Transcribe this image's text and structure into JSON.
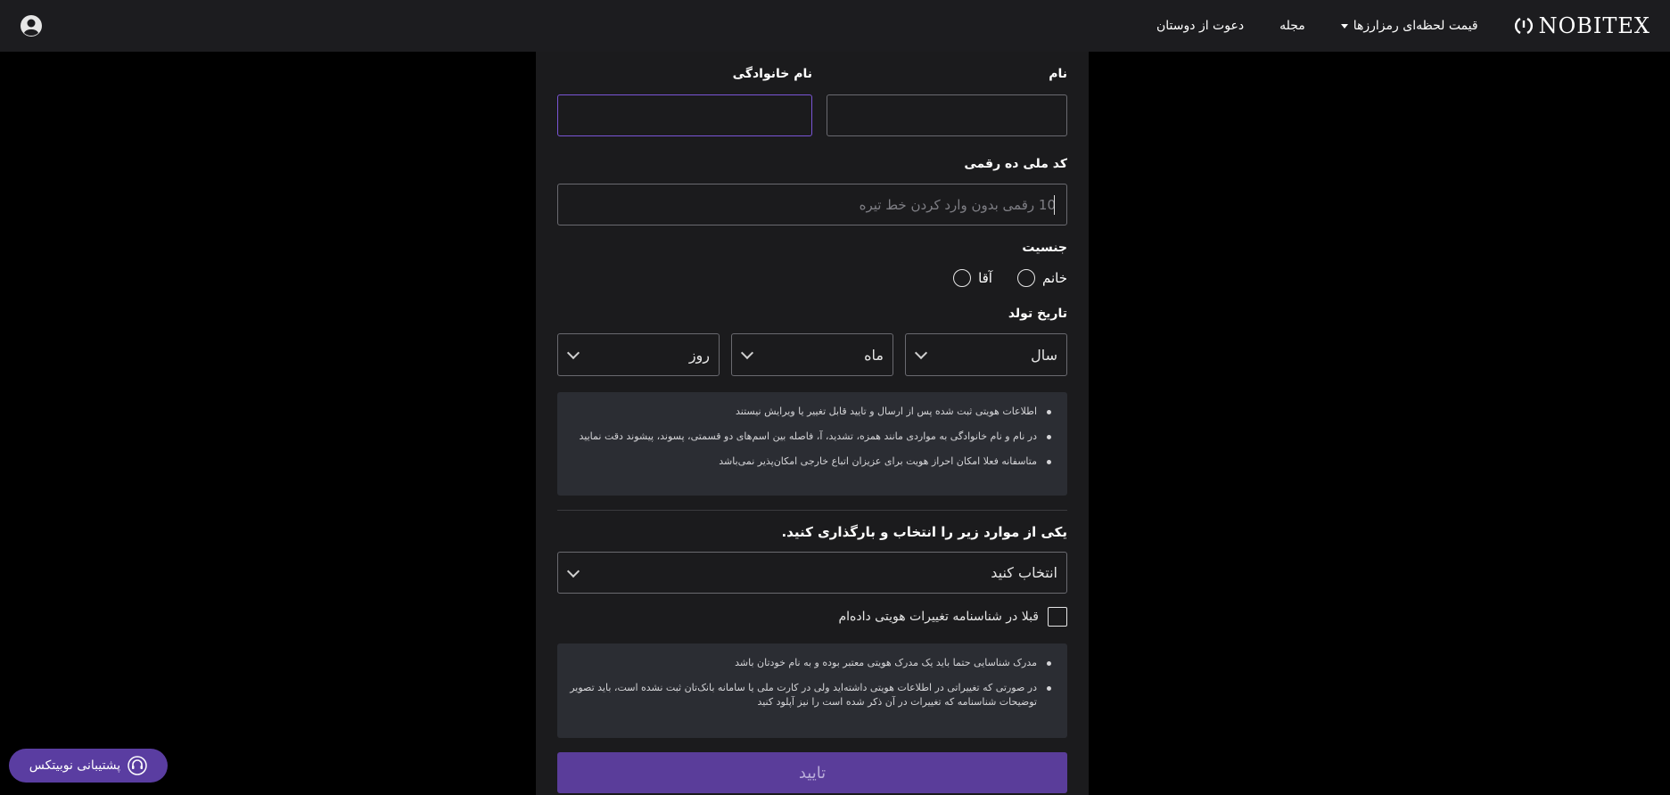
{
  "header": {
    "brand": "NOBITEX",
    "nav": {
      "prices": "قیمت لحظه‌ای رمزارزها",
      "magazine": "مجله",
      "invite": "دعوت از دوستان"
    }
  },
  "form": {
    "first_name_label": "نام",
    "last_name_label": "نام خانوادگی",
    "national_code_label": "کد ملی ده رقمی",
    "national_code_placeholder": "10 رقمی بدون وارد کردن خط تیره",
    "gender_label": "جنسیت",
    "gender_female": "خانم",
    "gender_male": "آقا",
    "birth_label": "تاریخ تولد",
    "birth_year": "سال",
    "birth_month": "ماه",
    "birth_day": "روز",
    "notes_1": [
      "اطلاعات هویتی ثبت شده پس از ارسال و تایید قابل تغییر یا ویرایش نیستند",
      "در نام و نام خانوادگی به مواردی مانند همزه، تشدید، آ، فاصله بین اسم‌های دو قسمتی، پسوند، پیشوند دقت نمایید",
      "متاسفانه فعلا امکان احراز هویت برای عزیزان اتباع خارجی امکان‌پذیر نمی‌باشد"
    ],
    "document_title": "یکی از موارد زیر را انتخاب و بارگذاری کنید.",
    "document_select": "انتخاب کنید",
    "identity_change_checkbox": "قبلا در شناسنامه تغییرات هویتی داده‌ام",
    "notes_2": [
      "مدرک شناسایی حتما باید یک مدرک هویتی معتبر بوده و به نام خودتان باشد",
      "در صورتی که تغییراتی در اطلاعات هویتی داشته‌اید ولی در کارت ملی یا سامانه بانک‌تان ثبت نشده است، باید تصویر توضیحات شناسنامه که تغییرات در آن ذکر شده است را نیز آپلود کنید"
    ],
    "submit": "تایید"
  },
  "support": {
    "label": "پشتیبانی نوبیتکس"
  },
  "colors": {
    "accent": "#5a3d9a",
    "header_bg": "#1c1c1f",
    "panel_bg": "#1b1b1d",
    "notice_bg": "#2b2d33"
  }
}
